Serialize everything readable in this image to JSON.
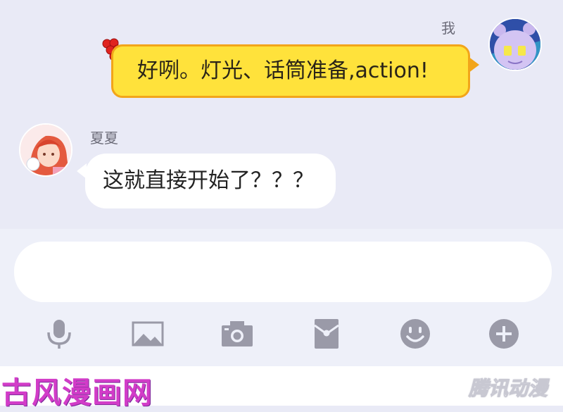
{
  "chat": {
    "messages": [
      {
        "sender": "我",
        "text": "好咧。灯光、话筒准备,action!",
        "side": "right",
        "bubble_color": "#ffe23b"
      },
      {
        "sender": "夏夏",
        "text": "这就直接开始了？？？",
        "side": "left",
        "bubble_color": "#ffffff"
      }
    ]
  },
  "input": {
    "value": "",
    "placeholder": ""
  },
  "toolbar": {
    "icons": [
      "microphone-icon",
      "image-icon",
      "camera-icon",
      "red-packet-icon",
      "emoji-icon",
      "add-icon"
    ],
    "icon_color": "#9a9aa8"
  },
  "watermarks": {
    "left": "古风漫画网",
    "right": "腾讯动漫"
  }
}
